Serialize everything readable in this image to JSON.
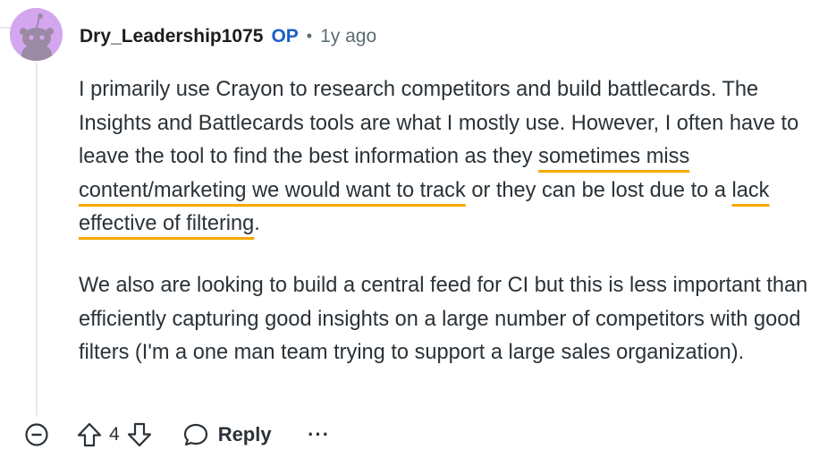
{
  "comment": {
    "username": "Dry_Leadership1075",
    "op_badge": "OP",
    "separator": "•",
    "time": "1y ago",
    "paragraph1": {
      "part1": "I primarily use Crayon to research competitors and build battlecards. The Insights and Battlecards tools are what I mostly use. However, I often have to leave the tool to find the best information as they ",
      "highlight1": "sometimes miss content/marketing we would want to track",
      "part2": " or they can be lost due to a ",
      "highlight2": "lack effective of filtering",
      "part3": "."
    },
    "paragraph2": "We also are looking to build a central feed for CI but this is less important than efficiently capturing good insights on a large number of competitors with good filters (I'm a one man team trying to support a large sales organization).",
    "highlight_color": "#f5a800"
  },
  "actions": {
    "score": "4",
    "reply_label": "Reply",
    "more_label": "···"
  },
  "icons": {
    "collapse": "collapse-minus-circle-icon",
    "upvote": "upvote-arrow-icon",
    "downvote": "downvote-arrow-icon",
    "reply": "speech-bubble-icon",
    "more": "more-dots-icon"
  },
  "colors": {
    "op": "#1a5ec9",
    "avatar_bg": "#d4a6f0",
    "meta": "#5c6c74"
  }
}
